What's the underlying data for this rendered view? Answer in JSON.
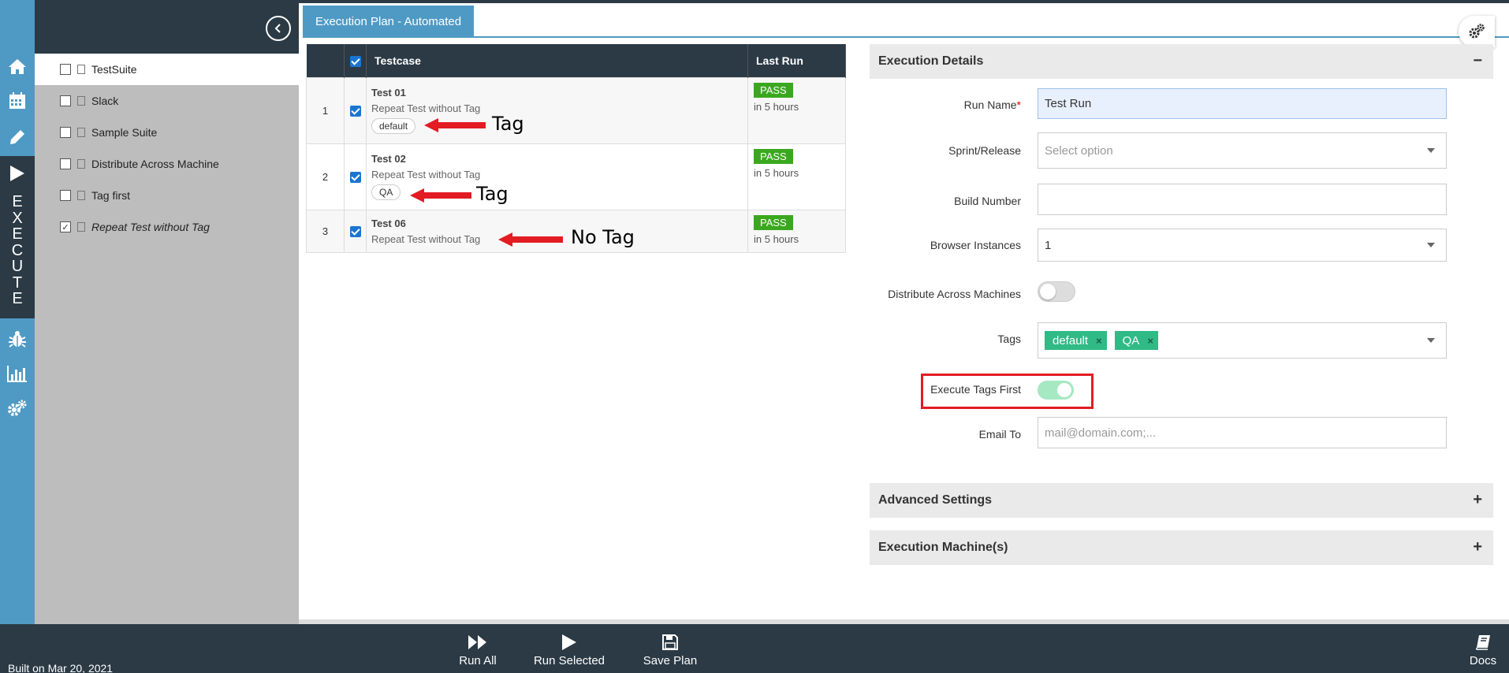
{
  "sidebar": {
    "rail_text": "EXECUTE",
    "icons": [
      "home-icon",
      "calendar-icon",
      "pencil-icon",
      "play-icon",
      "bug-icon",
      "bar-chart-icon",
      "cogs-icon"
    ]
  },
  "suites": [
    {
      "label": "TestSuite",
      "checked": false,
      "active": true,
      "italic": false
    },
    {
      "label": "Slack",
      "checked": false,
      "active": false,
      "italic": false
    },
    {
      "label": "Sample Suite",
      "checked": false,
      "active": false,
      "italic": false
    },
    {
      "label": "Distribute Across Machine",
      "checked": false,
      "active": false,
      "italic": false
    },
    {
      "label": "Tag first",
      "checked": false,
      "active": false,
      "italic": false
    },
    {
      "label": "Repeat Test without Tag",
      "checked": true,
      "active": false,
      "italic": true
    }
  ],
  "tab": {
    "label": "Execution Plan - Automated"
  },
  "table": {
    "headers": {
      "testcase": "Testcase",
      "last_run": "Last Run"
    },
    "rows": [
      {
        "num": "1",
        "title": "Test 01",
        "desc": "Repeat Test without Tag",
        "tag": "default",
        "status": "PASS",
        "time": "in 5 hours"
      },
      {
        "num": "2",
        "title": "Test 02",
        "desc": "Repeat Test without Tag",
        "tag": "QA",
        "status": "PASS",
        "time": "in 5 hours"
      },
      {
        "num": "3",
        "title": "Test 06",
        "desc": "Repeat Test without Tag",
        "tag": "",
        "status": "PASS",
        "time": "in 5 hours"
      }
    ]
  },
  "annotations": {
    "tag1": "Tag",
    "tag2": "Tag",
    "notag": "No Tag"
  },
  "execution": {
    "title": "Execution Details",
    "collapse_symbol": "−",
    "run_name_label": "Run Name",
    "required_mark": "*",
    "run_name_value": "Test Run",
    "sprint_label": "Sprint/Release",
    "sprint_placeholder": "Select option",
    "build_label": "Build Number",
    "build_value": "",
    "browser_label": "Browser Instances",
    "browser_value": "1",
    "distribute_label": "Distribute Across Machines",
    "distribute_on": false,
    "tags_label": "Tags",
    "tags": [
      "default",
      "QA"
    ],
    "tag_remove": "×",
    "exec_tags_first_label": "Execute Tags First",
    "exec_tags_first_on": true,
    "email_label": "Email To",
    "email_placeholder": "mail@domain.com;..."
  },
  "advanced": {
    "title": "Advanced Settings",
    "expand_symbol": "+"
  },
  "machines": {
    "title": "Execution Machine(s)",
    "expand_symbol": "+"
  },
  "footer": {
    "built": "Built on Mar 20, 2021",
    "run_all": "Run All",
    "run_selected": "Run Selected",
    "save_plan": "Save Plan",
    "docs": "Docs"
  },
  "colors": {
    "dark": "#2b3a45",
    "accent": "#4f9ac4",
    "pass": "#3aa81f",
    "chip": "#2fba86",
    "highlight_box": "#e31b23"
  }
}
